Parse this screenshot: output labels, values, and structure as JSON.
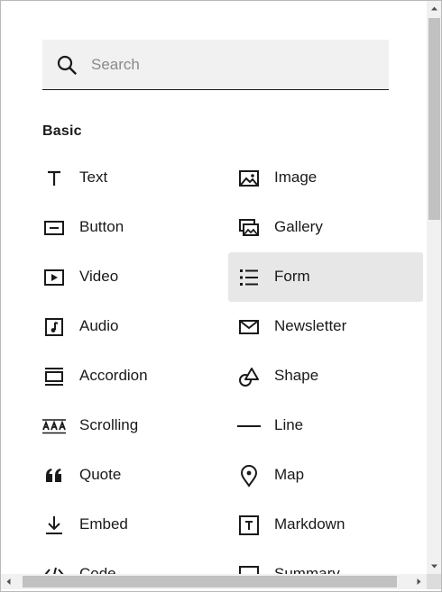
{
  "search": {
    "placeholder": "Search",
    "value": ""
  },
  "section": {
    "title": "Basic"
  },
  "blocks": [
    {
      "label": "Text",
      "icon": "text-icon"
    },
    {
      "label": "Image",
      "icon": "image-icon"
    },
    {
      "label": "Button",
      "icon": "button-icon"
    },
    {
      "label": "Gallery",
      "icon": "gallery-icon"
    },
    {
      "label": "Video",
      "icon": "video-icon"
    },
    {
      "label": "Form",
      "icon": "form-icon",
      "highlighted": true
    },
    {
      "label": "Audio",
      "icon": "audio-icon"
    },
    {
      "label": "Newsletter",
      "icon": "newsletter-icon"
    },
    {
      "label": "Accordion",
      "icon": "accordion-icon"
    },
    {
      "label": "Shape",
      "icon": "shape-icon"
    },
    {
      "label": "Scrolling",
      "icon": "scrolling-icon"
    },
    {
      "label": "Line",
      "icon": "line-icon"
    },
    {
      "label": "Quote",
      "icon": "quote-icon"
    },
    {
      "label": "Map",
      "icon": "map-pin-icon"
    },
    {
      "label": "Embed",
      "icon": "embed-icon"
    },
    {
      "label": "Markdown",
      "icon": "markdown-icon"
    },
    {
      "label": "Code",
      "icon": "code-icon"
    },
    {
      "label": "Summary",
      "icon": "summary-icon"
    }
  ],
  "colors": {
    "highlight": "#e7e7e7",
    "search_bg": "#f1f1f1",
    "text": "#1a1a1a",
    "scrollbar_thumb": "#c1c1c1"
  }
}
